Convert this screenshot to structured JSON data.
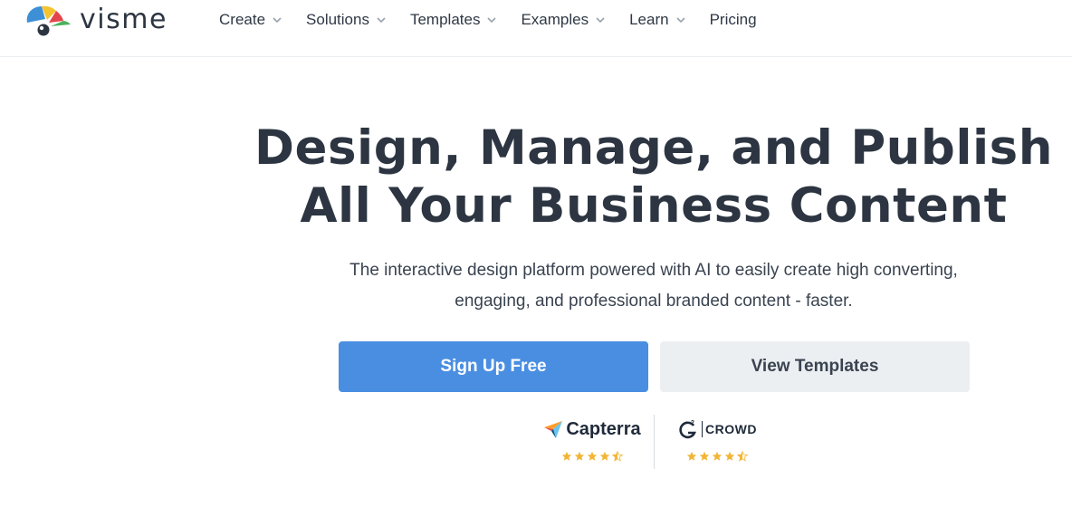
{
  "brand": {
    "name": "visme",
    "colors": {
      "logo_blue": "#3d8fd6",
      "logo_yellow": "#f4c430",
      "logo_red": "#e2464b",
      "logo_green": "#4bb35a",
      "logo_dark": "#2c3541"
    }
  },
  "nav": {
    "items": [
      {
        "label": "Create",
        "has_dropdown": true,
        "icon": "chevron-down-icon"
      },
      {
        "label": "Solutions",
        "has_dropdown": true,
        "icon": "chevron-down-icon"
      },
      {
        "label": "Templates",
        "has_dropdown": true,
        "icon": "chevron-down-icon"
      },
      {
        "label": "Examples",
        "has_dropdown": true,
        "icon": "chevron-down-icon"
      },
      {
        "label": "Learn",
        "has_dropdown": true,
        "icon": "chevron-down-icon"
      },
      {
        "label": "Pricing",
        "has_dropdown": false
      }
    ]
  },
  "hero": {
    "title_line1": "Design, Manage, and Publish",
    "title_line2": "All Your Business Content",
    "subtitle_line1": "The interactive design platform powered with AI to easily create high converting,",
    "subtitle_line2": "engaging, and professional branded content - faster."
  },
  "cta": {
    "primary_label": "Sign Up Free",
    "secondary_label": "View Templates",
    "primary_color": "#4a8ee2",
    "secondary_color": "#eceff2"
  },
  "ratings": [
    {
      "brand": "Capterra",
      "icon": "capterra-logo-icon",
      "stars": 4.5
    },
    {
      "brand": "G2 CROWD",
      "icon": "g2-logo-icon",
      "logo_text": "CROWD",
      "stars": 4.5
    }
  ],
  "star_color": "#f2b534"
}
